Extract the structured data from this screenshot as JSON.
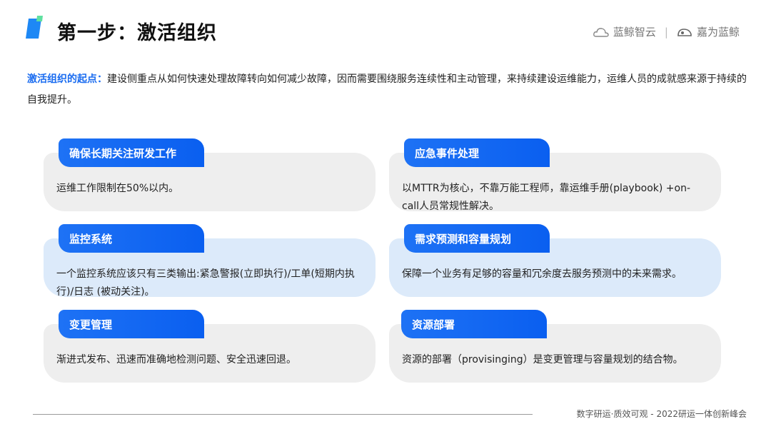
{
  "header": {
    "title": "第一步：激活组织",
    "logo_left": "蓝鲸智云",
    "separator": "|",
    "logo_right": "嘉为蓝鲸"
  },
  "intro": {
    "highlight": "激活组织的起点：",
    "text": "建设侧重点从如何快速处理故障转向如何减少故障，因而需要围绕服务连续性和主动管理，来持续建设运维能力，运维人员的成就感来源于持续的自我提升。"
  },
  "cards": [
    {
      "title": "确保长期关注研发工作",
      "text": "运维工作限制在50%以内。"
    },
    {
      "title": "应急事件处理",
      "text": "以MTTR为核心，不靠万能工程师，靠运维手册(playbook) +on-call人员常规性解决。"
    },
    {
      "title": "监控系统",
      "text": "一个监控系统应该只有三类输出:紧急警报(立即执行)/工单(短期内执行)/日志 (被动关注)。"
    },
    {
      "title": "需求预测和容量规划",
      "text": "保障一个业务有足够的容量和冗余度去服务预测中的未来需求。"
    },
    {
      "title": "变更管理",
      "text": "渐进式发布、迅速而准确地检测问题、安全迅速回退。"
    },
    {
      "title": "资源部署",
      "text": "资源的部署（provisinging）是变更管理与容量规划的结合物。"
    }
  ],
  "footer": {
    "text": "数字研运·质效可观  -  2022研运一体创新峰会"
  },
  "colors": {
    "accent": "#1a6cf0",
    "card_gray": "#eeeeee",
    "card_blue": "#dceafa"
  }
}
